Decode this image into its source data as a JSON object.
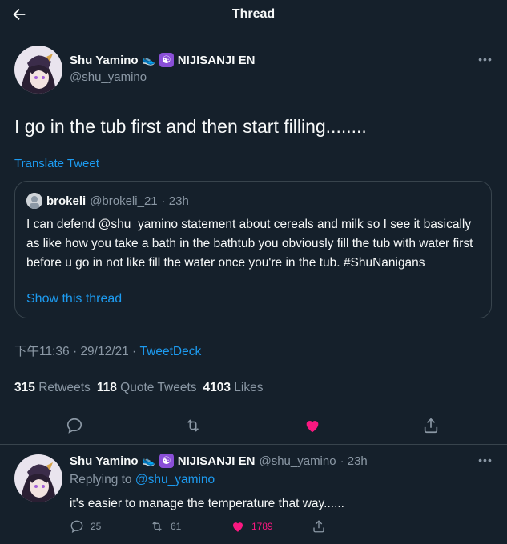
{
  "header": {
    "title": "Thread"
  },
  "tweet": {
    "display_name": "Shu Yamino",
    "org_name": "NIJISANJI EN",
    "handle": "@shu_yamino",
    "text": "I go in the tub first and then start filling........",
    "translate_label": "Translate Tweet",
    "quote": {
      "display_name": "brokeli",
      "handle": "@brokeli_21",
      "time": "· 23h",
      "text": "I can defend @shu_yamino statement about cereals and milk so I see it basically as like how you take a bath in the bathtub you obviously fill the tub with water first before u go in not like fill the water once you're in the tub. #ShuNanigans",
      "show_thread_label": "Show this thread"
    },
    "timestamp": "下午11:36 · 29/12/21 · ",
    "source": "TweetDeck",
    "stats": {
      "retweets_count": "315",
      "retweets_label": "Retweets",
      "quotes_count": "118",
      "quotes_label": "Quote Tweets",
      "likes_count": "4103",
      "likes_label": "Likes"
    }
  },
  "reply": {
    "display_name": "Shu Yamino",
    "org_name": "NIJISANJI EN",
    "handle": "@shu_yamino",
    "time": "· 23h",
    "replying_prefix": "Replying to",
    "replying_to": "@shu_yamino",
    "text": "it's easier to manage the temperature that way......",
    "replies": "25",
    "retweets": "61",
    "likes": "1789"
  },
  "colors": {
    "background": "#15202b",
    "accent": "#1d9bf0",
    "like": "#f91880",
    "secondary_text": "#8b98a5",
    "border": "#38444d"
  },
  "icons": {
    "back": "arrow-left-icon",
    "more": "more-horizontal-icon",
    "reply": "comment-icon",
    "retweet": "retweet-icon",
    "like": "heart-filled-icon",
    "share": "share-icon",
    "shoe": "shoe-emoji-icon",
    "yinyang": "yin-yang-emoji-icon"
  }
}
